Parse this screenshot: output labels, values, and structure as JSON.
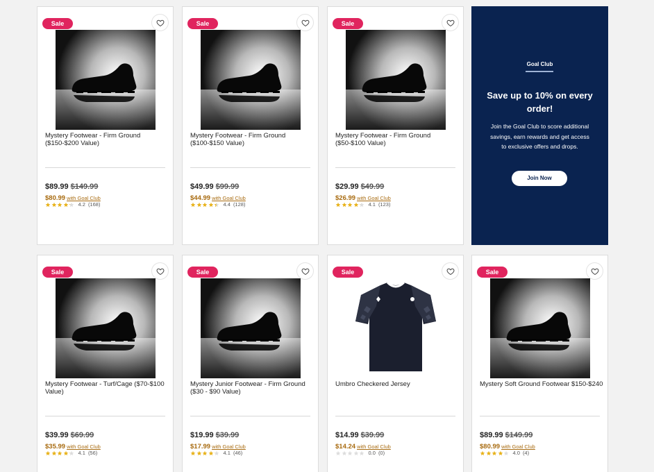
{
  "promo": {
    "kicker": "Goal Club",
    "title": "Save up to 10% on every order!",
    "body": "Join the Goal Club to score additional savings, earn rewards and get access to exclusive offers and drops.",
    "button_label": "Join Now",
    "background_color": "#0a2350"
  },
  "colors": {
    "sale_badge": "#e0245e",
    "club_price": "#a86b10",
    "star": "#e8b21a",
    "star_empty": "#dddddd"
  },
  "products": [
    {
      "badge": "Sale",
      "name": "Mystery Footwear - Firm Ground ($150-$200 Value)",
      "image": "shoe-silhouette",
      "price": "$89.99",
      "was_price": "$149.99",
      "club_price": "$80.99",
      "club_label": "with Goal Club",
      "rating": "4.2",
      "rating_value": 4.2,
      "review_count": "(168)"
    },
    {
      "badge": "Sale",
      "name": "Mystery Footwear - Firm Ground ($100-$150 Value)",
      "image": "shoe-silhouette",
      "price": "$49.99",
      "was_price": "$99.99",
      "club_price": "$44.99",
      "club_label": "with Goal Club",
      "rating": "4.4",
      "rating_value": 4.4,
      "review_count": "(128)"
    },
    {
      "badge": "Sale",
      "name": "Mystery Footwear - Firm Ground ($50-$100 Value)",
      "image": "shoe-silhouette",
      "price": "$29.99",
      "was_price": "$49.99",
      "club_price": "$26.99",
      "club_label": "with Goal Club",
      "rating": "4.1",
      "rating_value": 4.1,
      "review_count": "(123)"
    },
    {
      "badge": "Sale",
      "name": "Mystery Footwear - Turf/Cage ($70-$100 Value)",
      "image": "shoe-silhouette",
      "price": "$39.99",
      "was_price": "$69.99",
      "club_price": "$35.99",
      "club_label": "with Goal Club",
      "rating": "4.1",
      "rating_value": 4.1,
      "review_count": "(56)"
    },
    {
      "badge": "Sale",
      "name": "Mystery Junior Footwear - Firm Ground ($30 - $90 Value)",
      "image": "shoe-silhouette",
      "price": "$19.99",
      "was_price": "$39.99",
      "club_price": "$17.99",
      "club_label": "with Goal Club",
      "rating": "4.1",
      "rating_value": 4.1,
      "review_count": "(46)"
    },
    {
      "badge": "Sale",
      "name": "Umbro Checkered Jersey",
      "image": "jersey",
      "price": "$14.99",
      "was_price": "$39.99",
      "club_price": "$14.24",
      "club_label": "with Goal Club",
      "rating": "0.0",
      "rating_value": 0,
      "review_count": "(0)"
    },
    {
      "badge": "Sale",
      "name": "Mystery Soft Ground Footwear $150-$240",
      "image": "shoe-silhouette",
      "price": "$89.99",
      "was_price": "$149.99",
      "club_price": "$80.99",
      "club_label": "with Goal Club",
      "rating": "4.0",
      "rating_value": 4.0,
      "review_count": "(4)"
    }
  ]
}
